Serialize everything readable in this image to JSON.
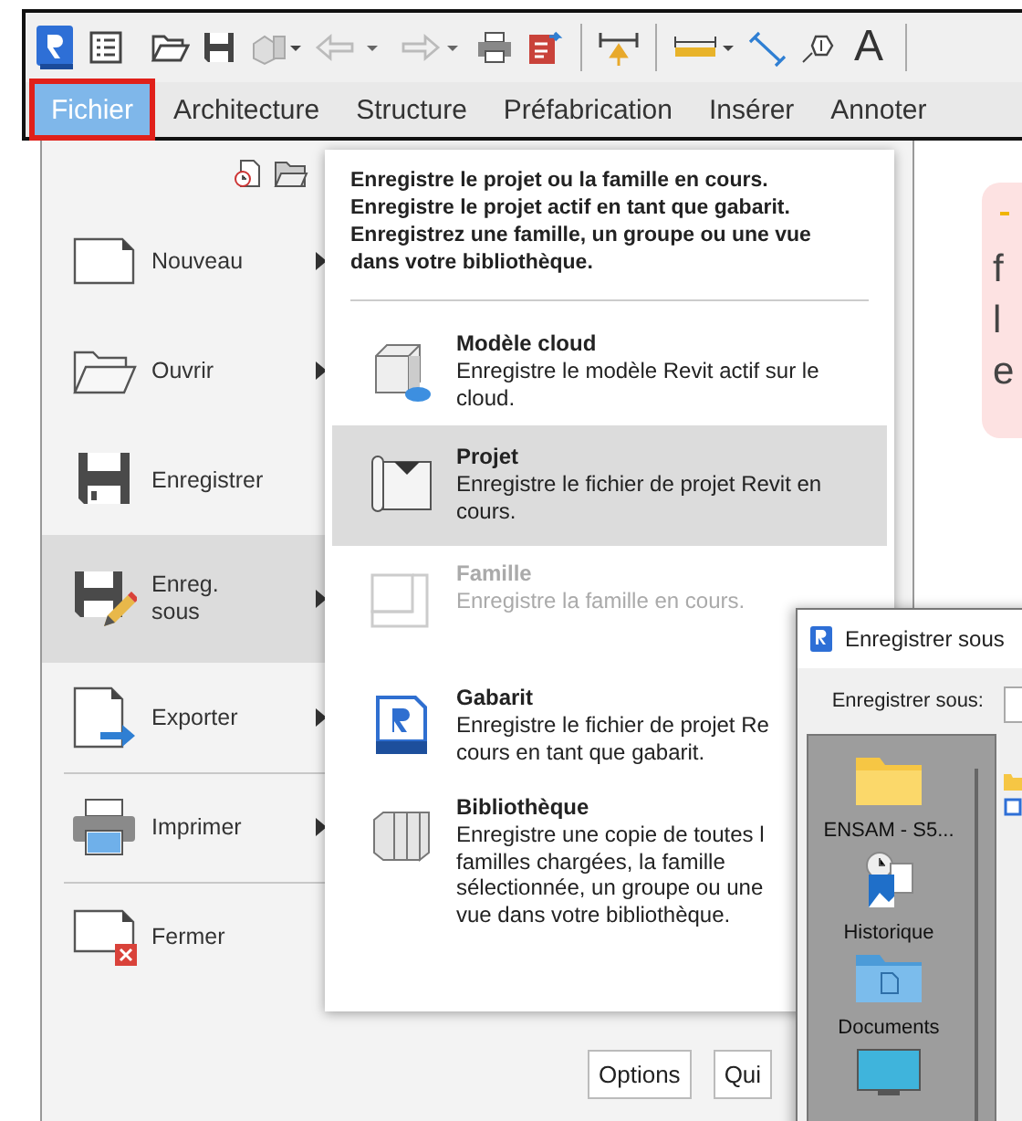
{
  "toolbar": {
    "text_tool_glyph": "A"
  },
  "tabs": [
    {
      "label": "Fichier",
      "selected": true
    },
    {
      "label": "Architecture",
      "selected": false
    },
    {
      "label": "Structure",
      "selected": false
    },
    {
      "label": "Préfabrication",
      "selected": false
    },
    {
      "label": "Insérer",
      "selected": false
    },
    {
      "label": "Annoter",
      "selected": false
    }
  ],
  "app_menu": {
    "items": [
      {
        "label": "Nouveau",
        "has_submenu": true,
        "selected": false,
        "divider_before": false
      },
      {
        "label": "Ouvrir",
        "has_submenu": true,
        "selected": false,
        "divider_before": false
      },
      {
        "label": "Enregistrer",
        "has_submenu": false,
        "selected": false,
        "divider_before": false
      },
      {
        "label": "Enreg.\nsous",
        "has_submenu": true,
        "selected": true,
        "divider_before": false
      },
      {
        "label": "Exporter",
        "has_submenu": true,
        "selected": false,
        "divider_before": false
      },
      {
        "label": "Imprimer",
        "has_submenu": true,
        "selected": false,
        "divider_before": true
      },
      {
        "label": "Fermer",
        "has_submenu": false,
        "selected": false,
        "divider_before": true
      }
    ],
    "buttons": [
      "Options",
      "Qui"
    ]
  },
  "submenu": {
    "header": "Enregistre le projet ou la famille en cours.\nEnregistre le projet actif en tant que gabarit.\nEnregistrez une famille, un groupe ou une vue\ndans votre bibliothèque.",
    "items": [
      {
        "title": "Modèle cloud",
        "desc_lines": [
          "Enregistre le modèle Revit actif sur le",
          "cloud."
        ],
        "selected": false,
        "disabled": false
      },
      {
        "title": "Projet",
        "desc_lines": [
          "Enregistre le fichier de projet Revit en",
          "cours."
        ],
        "selected": true,
        "disabled": false
      },
      {
        "title": "Famille",
        "desc_lines": [
          "Enregistre la famille en cours."
        ],
        "selected": false,
        "disabled": true
      },
      {
        "title": "Gabarit",
        "desc_lines": [
          "Enregistre le fichier de projet Re",
          "cours en tant que gabarit."
        ],
        "selected": false,
        "disabled": false
      },
      {
        "title": "Bibliothèque",
        "desc_lines": [
          "Enregistre une copie de toutes l",
          "familles chargées, la famille",
          "sélectionnée, un groupe ou une",
          "vue dans votre bibliothèque."
        ],
        "selected": false,
        "disabled": false
      }
    ]
  },
  "callout": {
    "lines": [
      "f",
      "l",
      "e"
    ]
  },
  "dialog": {
    "title": "Enregistrer sous",
    "save_in_label": "Enregistrer sous:",
    "places": [
      {
        "kind": "folder",
        "label": "ENSAM - S5..."
      },
      {
        "kind": "history",
        "label": "Historique"
      },
      {
        "kind": "documents",
        "label": "Documents"
      },
      {
        "kind": "desktop"
      }
    ]
  }
}
